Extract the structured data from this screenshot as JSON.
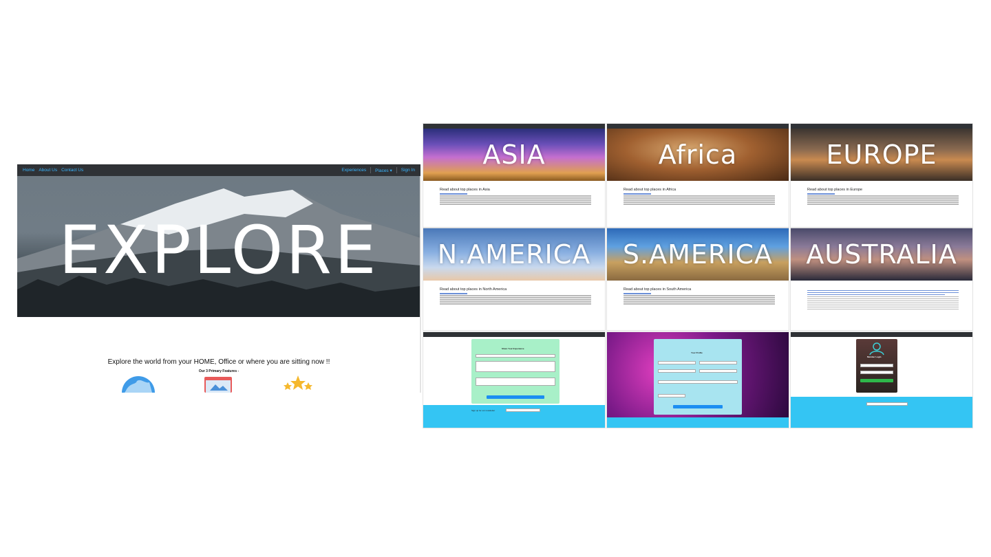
{
  "main": {
    "nav": {
      "left": [
        "Home",
        "About Us",
        "Contact Us"
      ],
      "right": [
        "Experiences",
        "Places ▾",
        "Sign In"
      ]
    },
    "hero_title": "EXPLORE",
    "tagline": "Explore the world from your HOME, Office or where you are sitting now !!",
    "features_heading": "Our 3 Primary Features -",
    "features": [
      "globe-icon",
      "browser-window-icon",
      "stars-icon"
    ]
  },
  "tiles": [
    {
      "banner": "ASIA",
      "heading": "Read about top places in Asia",
      "bg": "bg-asia"
    },
    {
      "banner": "Africa",
      "heading": "Read about top places in Africa",
      "bg": "bg-africa"
    },
    {
      "banner": "EUROPE",
      "heading": "Read about top places in Europe",
      "bg": "bg-europe"
    },
    {
      "banner": "N.AMERICA",
      "heading": "Read about top places in North America",
      "bg": "bg-namerica"
    },
    {
      "banner": "S.AMERICA",
      "heading": "Read about top places in South America",
      "bg": "bg-samerica"
    },
    {
      "banner": "AUSTRALIA",
      "heading": "",
      "bg": "bg-australia"
    }
  ],
  "forms": {
    "experience_title": "Share Your Experience",
    "profile_title": "Your Profile",
    "login_title": "Member Login",
    "submit_label": "Submit",
    "login_label": "Login",
    "signup_label": "Sign up for our newsletter"
  },
  "colors": {
    "nav_bg": "#2f3236",
    "nav_link": "#3ab6ff",
    "footer_blue": "#34c5f3",
    "form_green": "#a8f0c8"
  }
}
